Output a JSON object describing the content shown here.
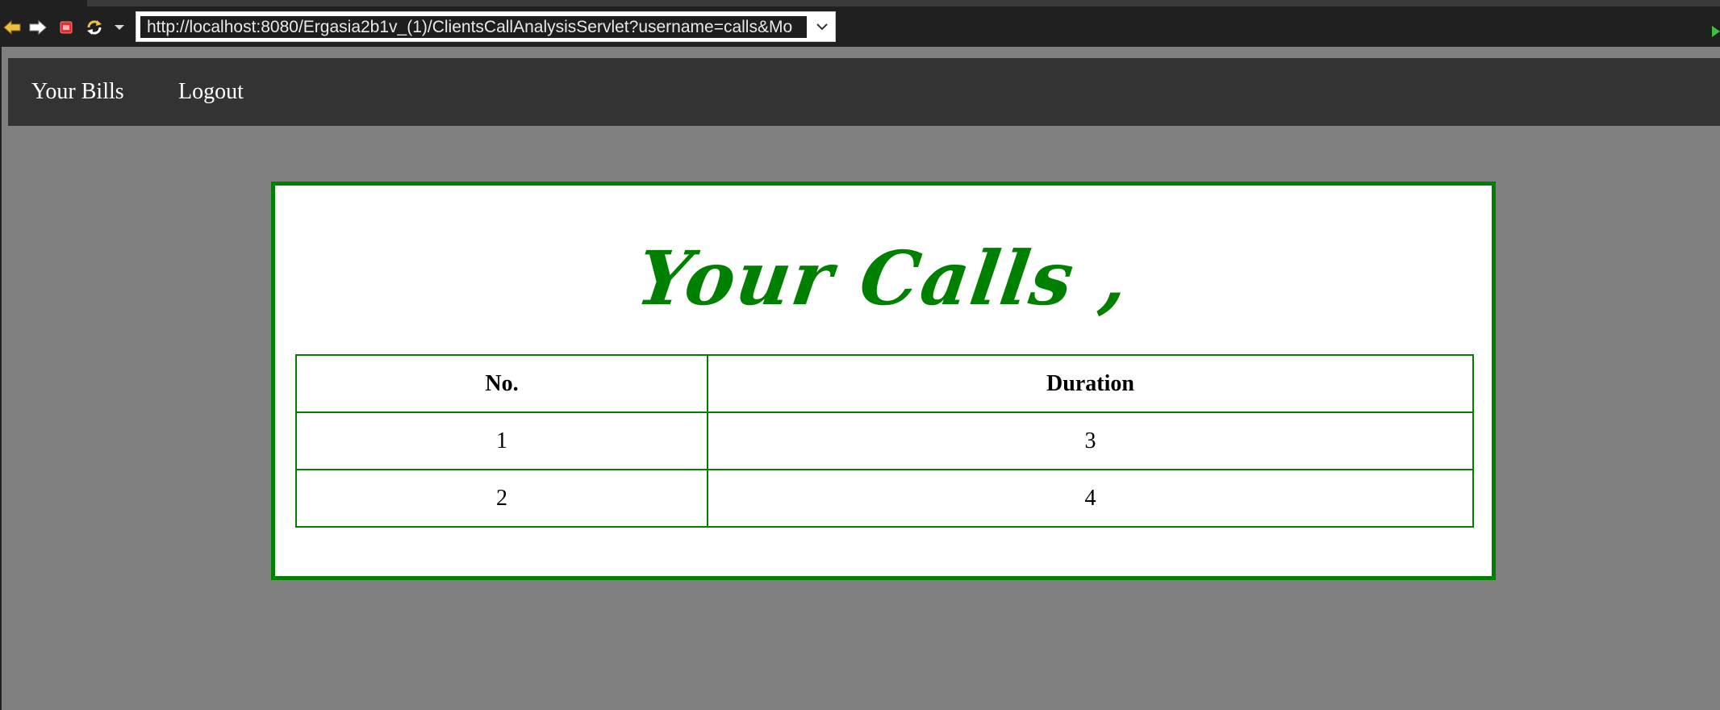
{
  "browser": {
    "url": "http://localhost:8080/Ergasia2b1v_(1)/ClientsCallAnalysisServlet?username=calls&Mo",
    "icons": [
      "back-arrow-icon",
      "forward-arrow-icon",
      "stop-icon",
      "reload-icon",
      "dropdown-icon",
      "go-icon"
    ],
    "colors": {
      "arrow": "#f0c040",
      "stop": "#e03030",
      "go": "#40c040"
    }
  },
  "nav": {
    "items": [
      {
        "label": "Your Bills"
      },
      {
        "label": "Logout"
      }
    ]
  },
  "panel": {
    "title": "Your Calls ,",
    "accent": "#008000",
    "table": {
      "columns": [
        "No.",
        "Duration"
      ],
      "rows": [
        [
          "1",
          "3"
        ],
        [
          "2",
          "4"
        ]
      ]
    }
  }
}
